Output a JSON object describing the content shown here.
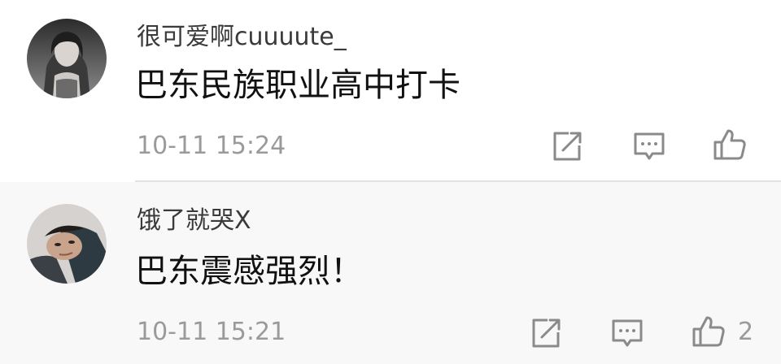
{
  "comments": [
    {
      "username": "很可爱啊cuuuute_",
      "content": "巴东民族职业高中打卡",
      "time": "10-11 15:24",
      "like_count": ""
    },
    {
      "username": "饿了就哭X",
      "content": "巴东震感强烈！",
      "time": "10-11 15:21",
      "like_count": "2"
    }
  ],
  "colors": {
    "username": "#3a3a3a",
    "content": "#111111",
    "meta": "#9a9a9a",
    "icon": "#8a8a8a",
    "divider": "#e3e3e3"
  },
  "icons": {
    "share": "share-icon",
    "reply": "comment-icon",
    "like": "thumbs-up-icon"
  }
}
